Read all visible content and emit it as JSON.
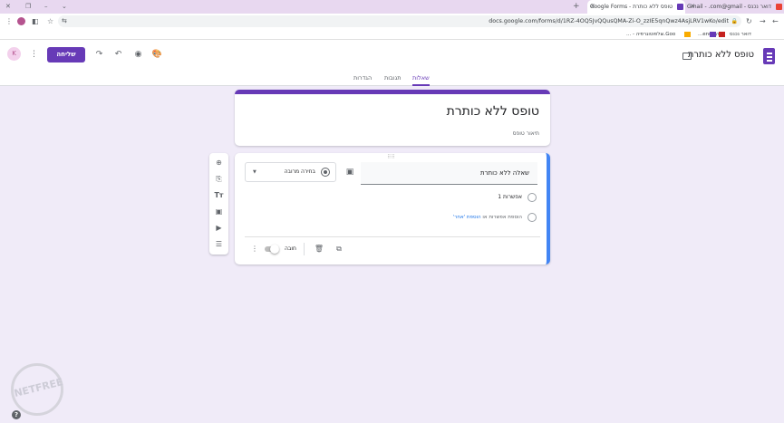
{
  "browser": {
    "tabs": [
      {
        "title": "דואר נכנס - Gmail - .com@gmail",
        "active": false
      },
      {
        "title": "טופס ללא כותרת - Google Forms",
        "active": true
      }
    ],
    "new_tab": "+",
    "url": "docs.google.com/forms/d/1RZ-4OQ5JvQQusQMA-Zi-O_zzIE5qnQwz4AsjLRV1wKo/edit",
    "bookmarks": [
      "דואר נכנס",
      "eneiiyo...",
      "אלפוטוגרפיה - ...",
      "Goo..."
    ]
  },
  "header": {
    "doc_title": "טופס ללא כותרת",
    "send_label": "שליחה",
    "avatar_initial": "K",
    "tabs": {
      "questions": "שאלות",
      "responses": "תגובות",
      "settings": "הגדרות"
    }
  },
  "form": {
    "title": "טופס ללא כותרת",
    "description_placeholder": "תיאור טופס"
  },
  "question": {
    "text": "שאלה ללא כותרת",
    "type": "בחירה מרובה",
    "option1": "אפשרות 1",
    "add_option": "הוספת אפשרות",
    "or": "או",
    "add_other": "הוספת 'אחר'",
    "required_label": "חובה",
    "required": false
  },
  "watermark": "NETFREE",
  "colors": {
    "primary": "#673ab7",
    "focus": "#4285f4",
    "background": "#f0ebf8"
  }
}
